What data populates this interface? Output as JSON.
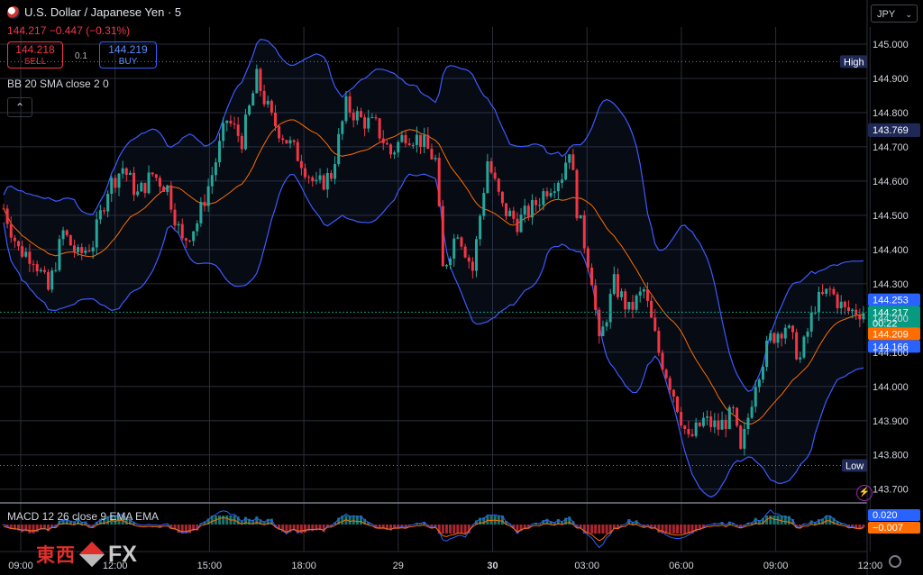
{
  "header": {
    "title": "U.S. Dollar / Japanese Yen · 5",
    "quote": "144.217 −0.447 (−0.31%)"
  },
  "trade": {
    "sell_price": "144.218",
    "sell_label": "SELL",
    "spread": "0.1",
    "buy_price": "144.219",
    "buy_label": "BUY"
  },
  "indicators": {
    "bb": "BB 20 SMA close 2 0",
    "macd": "MACD 12 26 close 9 EMA EMA"
  },
  "currency_selector": "JPY",
  "logo": {
    "cn": "東西",
    "fx": "FX"
  },
  "colors": {
    "up": "#26a69a",
    "down": "#f23645",
    "bb_band": "#3d5afe",
    "bb_basis": "#ff6d00",
    "grid": "#2a2e39",
    "high_low_label": "#1e2a55"
  },
  "chart_data": {
    "type": "candlestick",
    "y_axis": {
      "ticks": [
        "145.000",
        "144.900",
        "144.800",
        "144.700",
        "144.600",
        "144.500",
        "144.400",
        "144.300",
        "144.200",
        "144.100",
        "144.000",
        "143.900",
        "143.800",
        "143.700"
      ],
      "range": [
        143.665,
        145.05
      ]
    },
    "x_axis": {
      "ticks": [
        "09:00",
        "12:00",
        "15:00",
        "18:00",
        "29",
        "30",
        "03:00",
        "06:00",
        "09:00",
        "12:00"
      ]
    },
    "markers": {
      "high": {
        "label": "High",
        "value": "144.949"
      },
      "low": {
        "label": "Low",
        "value": "143.769"
      }
    },
    "price_tags": [
      {
        "value": "144.253",
        "color": "#2962ff",
        "role": "bb-upper"
      },
      {
        "value": "144.217",
        "color": "#089981",
        "role": "last-price"
      },
      {
        "value": "00:22",
        "color": "#089981",
        "role": "countdown"
      },
      {
        "value": "144.209",
        "color": "#ff6d00",
        "role": "bb-basis"
      },
      {
        "value": "144.166",
        "color": "#2962ff",
        "role": "bb-lower"
      }
    ],
    "price_path": [
      [
        0,
        144.52
      ],
      [
        4,
        144.4
      ],
      [
        8,
        144.38
      ],
      [
        12,
        144.28
      ],
      [
        16,
        144.45
      ],
      [
        20,
        144.38
      ],
      [
        24,
        144.42
      ],
      [
        28,
        144.58
      ],
      [
        32,
        144.64
      ],
      [
        36,
        144.56
      ],
      [
        40,
        144.62
      ],
      [
        44,
        144.58
      ],
      [
        48,
        144.42
      ],
      [
        52,
        144.48
      ],
      [
        56,
        144.62
      ],
      [
        60,
        144.78
      ],
      [
        64,
        144.72
      ],
      [
        68,
        144.9
      ],
      [
        72,
        144.78
      ],
      [
        76,
        144.72
      ],
      [
        80,
        144.66
      ],
      [
        84,
        144.58
      ],
      [
        88,
        144.62
      ],
      [
        92,
        144.82
      ],
      [
        96,
        144.78
      ],
      [
        100,
        144.76
      ],
      [
        104,
        144.68
      ],
      [
        108,
        144.74
      ],
      [
        112,
        144.72
      ],
      [
        116,
        144.66
      ],
      [
        118,
        144.34
      ],
      [
        122,
        144.46
      ],
      [
        126,
        144.34
      ],
      [
        130,
        144.66
      ],
      [
        134,
        144.52
      ],
      [
        138,
        144.48
      ],
      [
        142,
        144.52
      ],
      [
        146,
        144.58
      ],
      [
        150,
        144.62
      ],
      [
        152,
        144.7
      ],
      [
        154,
        144.52
      ],
      [
        158,
        144.32
      ],
      [
        160,
        144.12
      ],
      [
        164,
        144.3
      ],
      [
        168,
        144.22
      ],
      [
        172,
        144.28
      ],
      [
        176,
        144.1
      ],
      [
        180,
        143.98
      ],
      [
        184,
        143.84
      ],
      [
        188,
        143.9
      ],
      [
        192,
        143.88
      ],
      [
        196,
        143.92
      ],
      [
        198,
        143.8
      ],
      [
        202,
        144.02
      ],
      [
        206,
        144.14
      ],
      [
        210,
        144.18
      ],
      [
        214,
        144.08
      ],
      [
        218,
        144.24
      ],
      [
        222,
        144.28
      ],
      [
        226,
        144.22
      ]
    ],
    "macd": {
      "tags": [
        "0.020",
        "−0.007"
      ]
    }
  }
}
